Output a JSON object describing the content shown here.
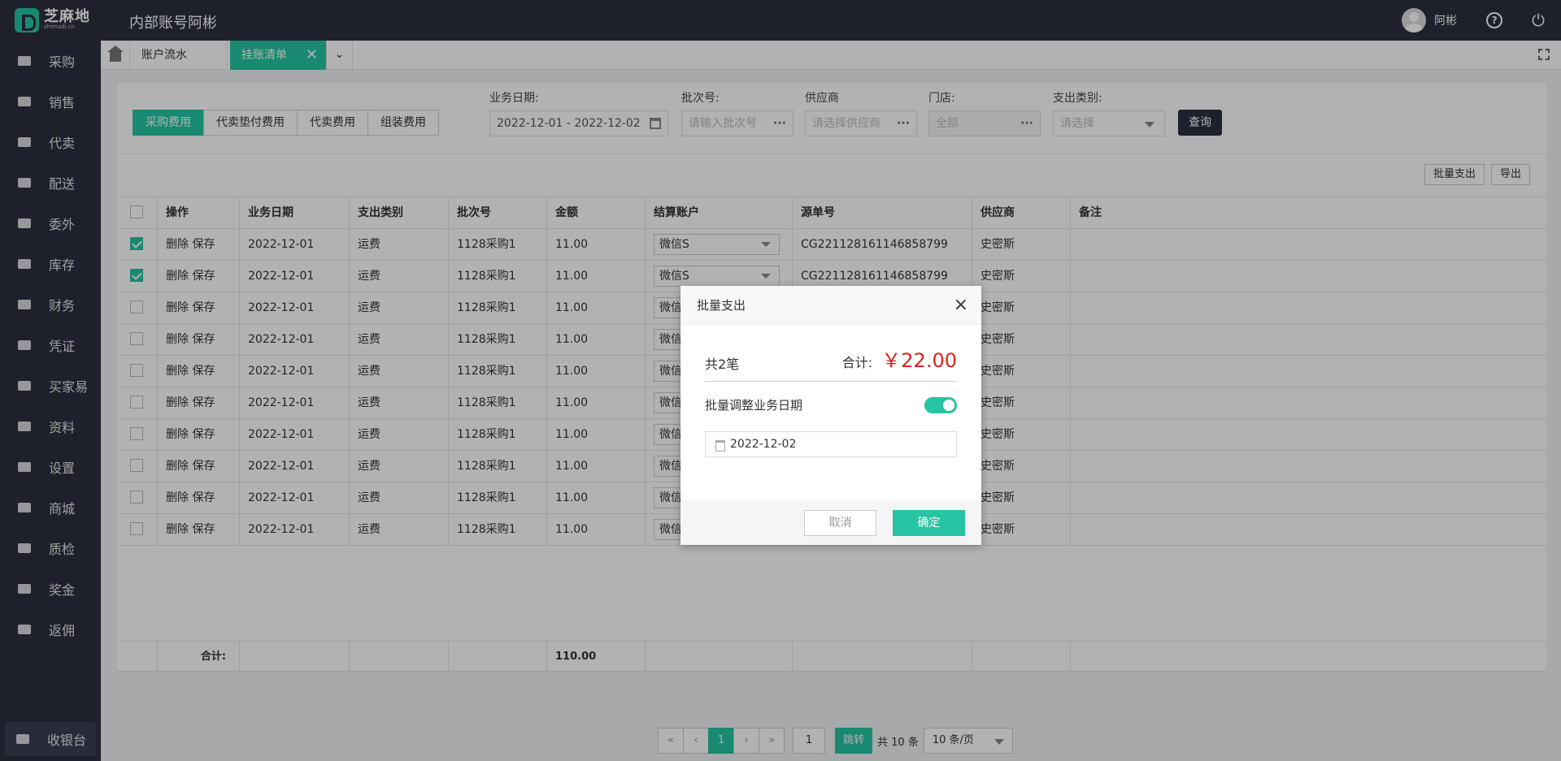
{
  "header": {
    "logo_text": "芝麻地",
    "logo_sub": "zhimadi.cn",
    "title": "内部账号阿彬",
    "user": "阿彬"
  },
  "sidebar": {
    "items": [
      "采购",
      "销售",
      "代卖",
      "配送",
      "委外",
      "库存",
      "财务",
      "凭证",
      "买家易",
      "资料",
      "设置",
      "商城",
      "质检",
      "奖金",
      "返佣"
    ],
    "cashier": "收银台"
  },
  "tabs": {
    "tab1": "账户流水",
    "tab2": "挂账清单"
  },
  "filter": {
    "segments": [
      "采购费用",
      "代卖垫付费用",
      "代卖费用",
      "组装费用"
    ],
    "labels": {
      "date": "业务日期:",
      "batch": "批次号:",
      "supplier": "供应商",
      "store": "门店:",
      "expense_type": "支出类别:"
    },
    "date_value": "2022-12-01 - 2022-12-02",
    "batch_placeholder": "请输入批次号",
    "supplier_placeholder": "请选择供应商",
    "store_value": "全部",
    "expense_placeholder": "请选择",
    "query": "查询"
  },
  "actions": {
    "batch_pay": "批量支出",
    "export": "导出"
  },
  "table": {
    "headers": [
      "操作",
      "业务日期",
      "支出类别",
      "批次号",
      "金额",
      "结算账户",
      "源单号",
      "供应商",
      "备注"
    ],
    "rows": [
      {
        "op": "删除 保存",
        "date": "2022-12-01",
        "type": "运费",
        "batch": "1128采购1",
        "amount": "11.00",
        "account": "微信S",
        "source": "CG221128161146858799",
        "supplier": "史密斯",
        "note": "",
        "checked": true
      },
      {
        "op": "删除 保存",
        "date": "2022-12-01",
        "type": "运费",
        "batch": "1128采购1",
        "amount": "11.00",
        "account": "微信S",
        "source": "CG221128161146858799",
        "supplier": "史密斯",
        "note": "",
        "checked": true
      },
      {
        "op": "删除 保存",
        "date": "2022-12-01",
        "type": "运费",
        "batch": "1128采购1",
        "amount": "11.00",
        "account": "微信S",
        "source": "",
        "supplier": "史密斯",
        "note": "",
        "checked": false
      },
      {
        "op": "删除 保存",
        "date": "2022-12-01",
        "type": "运费",
        "batch": "1128采购1",
        "amount": "11.00",
        "account": "微信S",
        "source": "",
        "supplier": "史密斯",
        "note": "",
        "checked": false
      },
      {
        "op": "删除 保存",
        "date": "2022-12-01",
        "type": "运费",
        "batch": "1128采购1",
        "amount": "11.00",
        "account": "微信S",
        "source": "",
        "supplier": "史密斯",
        "note": "",
        "checked": false
      },
      {
        "op": "删除 保存",
        "date": "2022-12-01",
        "type": "运费",
        "batch": "1128采购1",
        "amount": "11.00",
        "account": "微信S",
        "source": "",
        "supplier": "史密斯",
        "note": "",
        "checked": false
      },
      {
        "op": "删除 保存",
        "date": "2022-12-01",
        "type": "运费",
        "batch": "1128采购1",
        "amount": "11.00",
        "account": "微信S",
        "source": "",
        "supplier": "史密斯",
        "note": "",
        "checked": false
      },
      {
        "op": "删除 保存",
        "date": "2022-12-01",
        "type": "运费",
        "batch": "1128采购1",
        "amount": "11.00",
        "account": "微信S",
        "source": "",
        "supplier": "史密斯",
        "note": "",
        "checked": false
      },
      {
        "op": "删除 保存",
        "date": "2022-12-01",
        "type": "运费",
        "batch": "1128采购1",
        "amount": "11.00",
        "account": "微信S",
        "source": "",
        "supplier": "史密斯",
        "note": "",
        "checked": false
      },
      {
        "op": "删除 保存",
        "date": "2022-12-01",
        "type": "运费",
        "batch": "1128采购1",
        "amount": "11.00",
        "account": "微信S",
        "source": "",
        "supplier": "史密斯",
        "note": "",
        "checked": false
      }
    ],
    "footer_label": "合计:",
    "footer_amount": "110.00"
  },
  "pagination": {
    "current": "1",
    "page_input": "1",
    "jump": "跳转",
    "total": "共 10 条",
    "page_size": "10 条/页"
  },
  "modal": {
    "title": "批量支出",
    "count": "共2笔",
    "total_label": "合计:",
    "total_amount": "￥22.00",
    "toggle_label": "批量调整业务日期",
    "toggle_on": true,
    "date": "2022-12-02",
    "cancel": "取消",
    "ok": "确定"
  },
  "colors": {
    "accent": "#26c4a2",
    "dark": "#2b3040",
    "amount_red": "#e02020"
  }
}
